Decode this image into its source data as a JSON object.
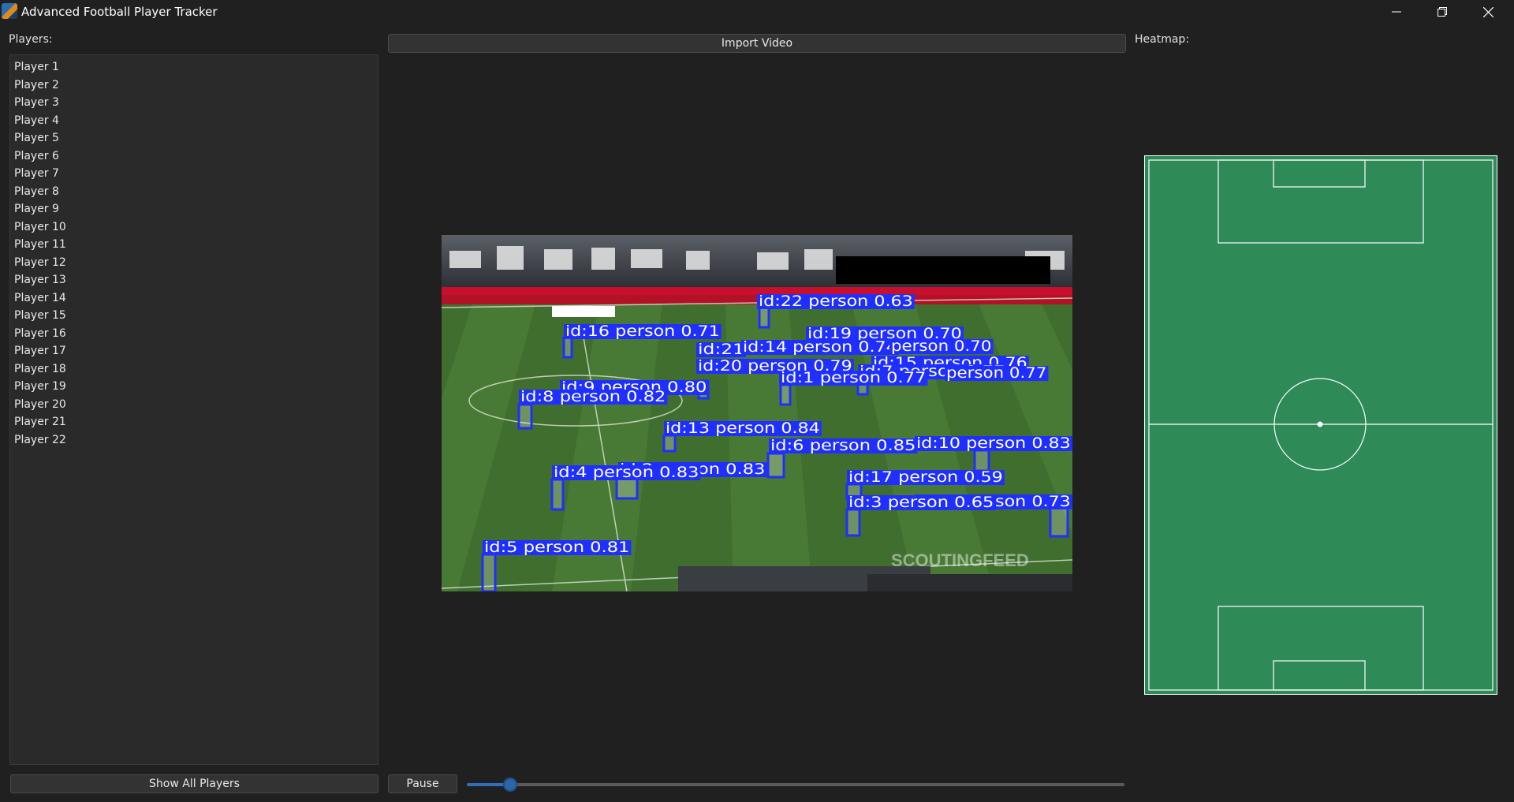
{
  "window": {
    "title": "Advanced Football Player Tracker"
  },
  "left_panel": {
    "label": "Players:",
    "players": [
      "Player 1",
      "Player 2",
      "Player 3",
      "Player 4",
      "Player 5",
      "Player 6",
      "Player 7",
      "Player 8",
      "Player 9",
      "Player 10",
      "Player 11",
      "Player 12",
      "Player 13",
      "Player 14",
      "Player 15",
      "Player 16",
      "Player 17",
      "Player 18",
      "Player 19",
      "Player 20",
      "Player 21",
      "Player 22"
    ],
    "show_all_label": "Show All Players"
  },
  "center": {
    "import_label": "Import Video",
    "pause_label": "Pause",
    "progress_fraction": 0.03,
    "detections": [
      {
        "label": "id:22 person 0.63"
      },
      {
        "label": "id:16 person 0.71"
      },
      {
        "label": "id:19 person 0.70"
      },
      {
        "label": "id:21"
      },
      {
        "label": "id:14 person 0.74"
      },
      {
        "label": "person 0.70"
      },
      {
        "label": "id:15 person 0.76"
      },
      {
        "label": "id:20 person 0.79"
      },
      {
        "label": "id:7 person 0.77"
      },
      {
        "label": "person 0.77"
      },
      {
        "label": "id:1 person 0.77"
      },
      {
        "label": "id:9 person 0.80"
      },
      {
        "label": "id:8 person 0.82"
      },
      {
        "label": "id:13 person 0.84"
      },
      {
        "label": "id:6 person 0.85"
      },
      {
        "label": "id:10 person 0.83"
      },
      {
        "label": "id:2 person 0.83"
      },
      {
        "label": "id:4 person 0.83"
      },
      {
        "label": "id:17 person 0.59"
      },
      {
        "label": "id:11 person 0.73"
      },
      {
        "label": "id:3 person 0.65"
      },
      {
        "label": "id:5 person 0.81"
      }
    ],
    "watermark": "SCOUTINGFEED",
    "colors": {
      "box": "#1f2fff"
    }
  },
  "right_panel": {
    "label": "Heatmap:",
    "colors": {
      "pitch": "#2e8b57",
      "lines": "#ffffff"
    }
  }
}
